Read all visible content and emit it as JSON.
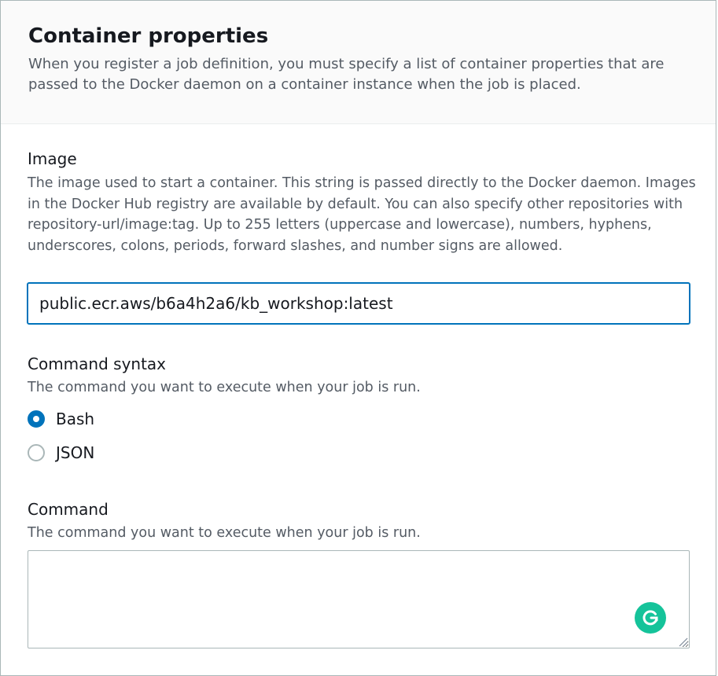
{
  "section": {
    "title": "Container properties",
    "description": "When you register a job definition, you must specify a list of container properties that are passed to the Docker daemon on a container instance when the job is placed."
  },
  "image": {
    "label": "Image",
    "description": "The image used to start a container. This string is passed directly to the Docker daemon. Images in the Docker Hub registry are available by default. You can also specify other repositories with repository-url/image:tag. Up to 255 letters (uppercase and lowercase), numbers, hyphens, underscores, colons, periods, forward slashes, and number signs are allowed.",
    "value": "public.ecr.aws/b6a4h2a6/kb_workshop:latest"
  },
  "command_syntax": {
    "label": "Command syntax",
    "description": "The command you want to execute when your job is run.",
    "options": [
      {
        "label": "Bash",
        "selected": true
      },
      {
        "label": "JSON",
        "selected": false
      }
    ]
  },
  "command": {
    "label": "Command",
    "description": "The command you want to execute when your job is run.",
    "value": ""
  },
  "colors": {
    "accent": "#0073bb",
    "grammarly": "#15c39a"
  },
  "icons": {
    "grammarly": "grammarly-icon",
    "resize": "resize-handle-icon"
  }
}
